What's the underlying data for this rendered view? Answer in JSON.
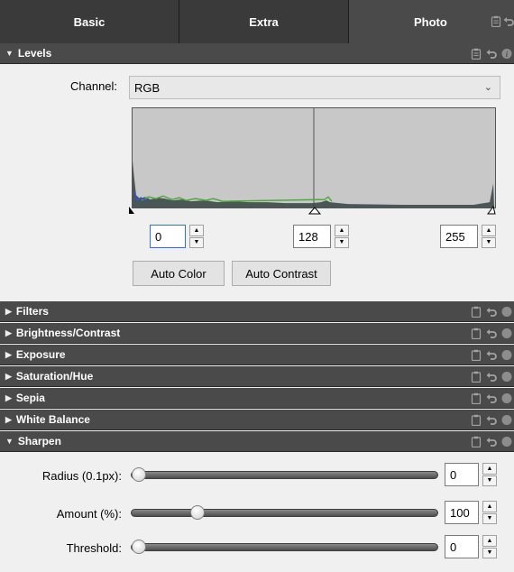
{
  "tabs": [
    {
      "label": "Basic"
    },
    {
      "label": "Extra"
    },
    {
      "label": "Photo"
    }
  ],
  "levels": {
    "title": "Levels",
    "channel_label": "Channel:",
    "channel_value": "RGB",
    "black_input": "0",
    "mid_input": "128",
    "white_input": "255",
    "auto_color_label": "Auto Color",
    "auto_contrast_label": "Auto Contrast"
  },
  "sections": {
    "filters": "Filters",
    "brightness": "Brightness/Contrast",
    "exposure": "Exposure",
    "saturation": "Saturation/Hue",
    "sepia": "Sepia",
    "white_balance": "White Balance",
    "sharpen": "Sharpen"
  },
  "sharpen": {
    "radius_label": "Radius (0.1px):",
    "radius_value": "0",
    "radius_level": 0,
    "amount_label": "Amount (%):",
    "amount_value": "100",
    "amount_level": 0.2,
    "threshold_label": "Threshold:",
    "threshold_value": "0",
    "threshold_level": 0
  },
  "icons": {
    "header": [
      "clipboard-icon",
      "undo-icon",
      "info-icon"
    ]
  }
}
